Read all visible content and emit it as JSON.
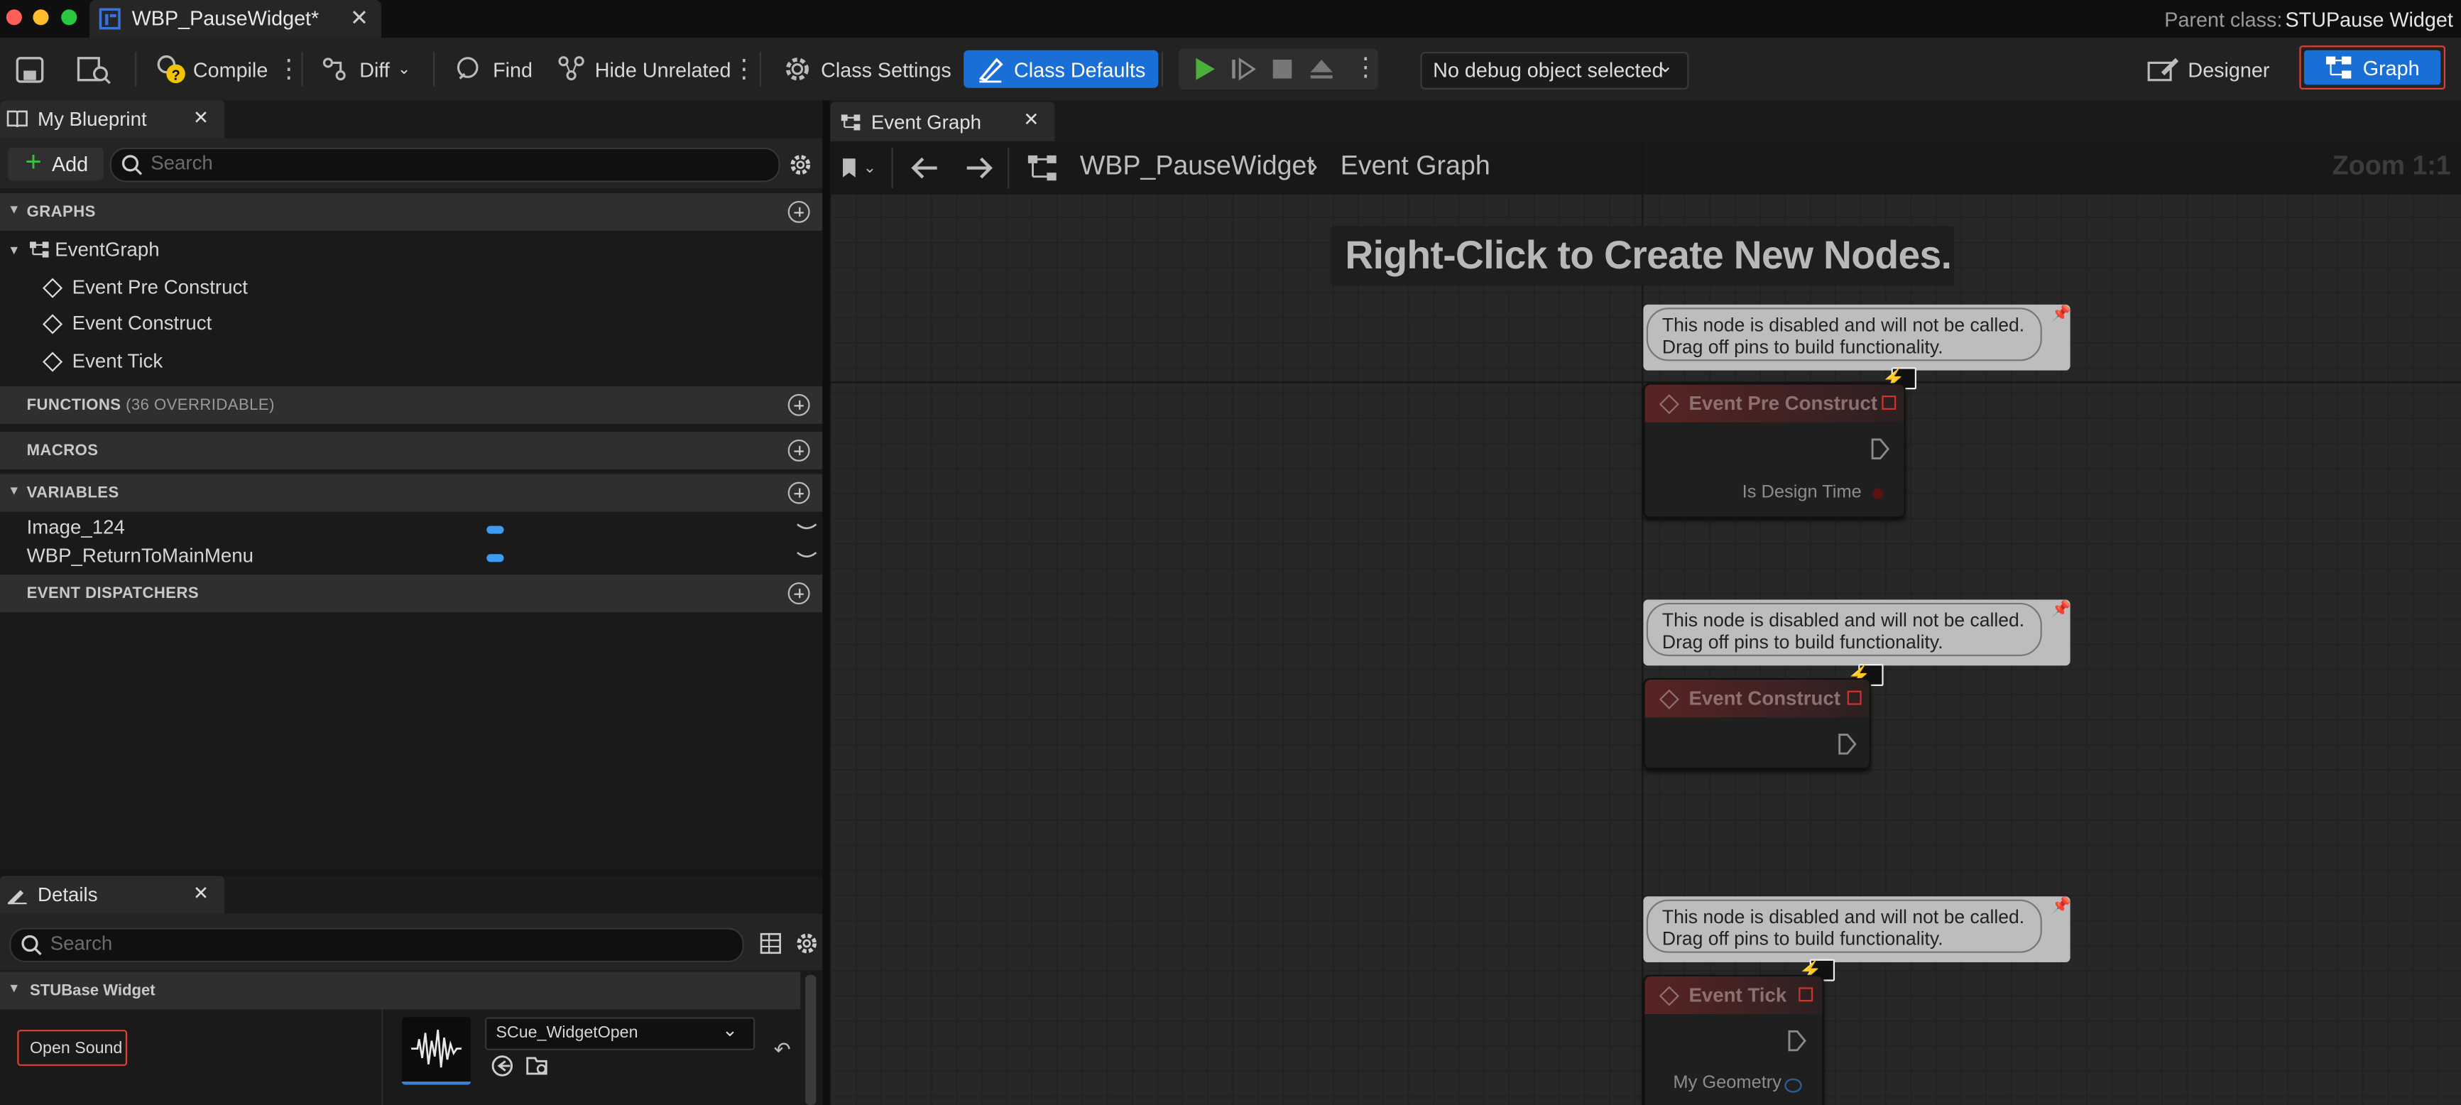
{
  "window": {
    "tab_title": "WBP_PauseWidget*",
    "parent_class_label": "Parent class:",
    "parent_class_value": "STUPause Widget"
  },
  "toolbar": {
    "compile": "Compile",
    "diff": "Diff",
    "find": "Find",
    "hide_unrelated": "Hide Unrelated",
    "class_settings": "Class Settings",
    "class_defaults": "Class Defaults",
    "debug_dropdown": "No debug object selected",
    "designer": "Designer",
    "graph": "Graph"
  },
  "my_blueprint": {
    "tab_label": "My Blueprint",
    "add_label": "Add",
    "search_placeholder": "Search",
    "sections": {
      "graphs": "GRAPHS",
      "functions": "FUNCTIONS",
      "functions_note": "(36 OVERRIDABLE)",
      "macros": "MACROS",
      "variables": "VARIABLES",
      "event_dispatchers": "EVENT DISPATCHERS"
    },
    "graph_root": "EventGraph",
    "events": [
      "Event Pre Construct",
      "Event Construct",
      "Event Tick"
    ],
    "variables": [
      "Image_124",
      "WBP_ReturnToMainMenu"
    ]
  },
  "details": {
    "tab_label": "Details",
    "search_placeholder": "Search",
    "category": "STUBase Widget",
    "property_label": "Open Sound",
    "asset_value": "SCue_WidgetOpen"
  },
  "graph": {
    "tab_label": "Event Graph",
    "breadcrumb_root": "WBP_PauseWidget",
    "breadcrumb_leaf": "Event Graph",
    "zoom": "Zoom 1:1",
    "hint": "Right-Click to Create New Nodes.",
    "comment_line1": "This node is disabled and will not be called.",
    "comment_line2": "Drag off pins to build functionality.",
    "nodes": [
      {
        "title": "Event Pre Construct",
        "pin": "Is Design Time"
      },
      {
        "title": "Event Construct",
        "pin": ""
      },
      {
        "title": "Event Tick",
        "pin": "My Geometry"
      }
    ]
  },
  "colors": {
    "accent_blue": "#1a6fd6",
    "highlight_red": "#e0402f",
    "variable_blue": "#3d9cf0",
    "node_header_red": "#5a2323"
  }
}
